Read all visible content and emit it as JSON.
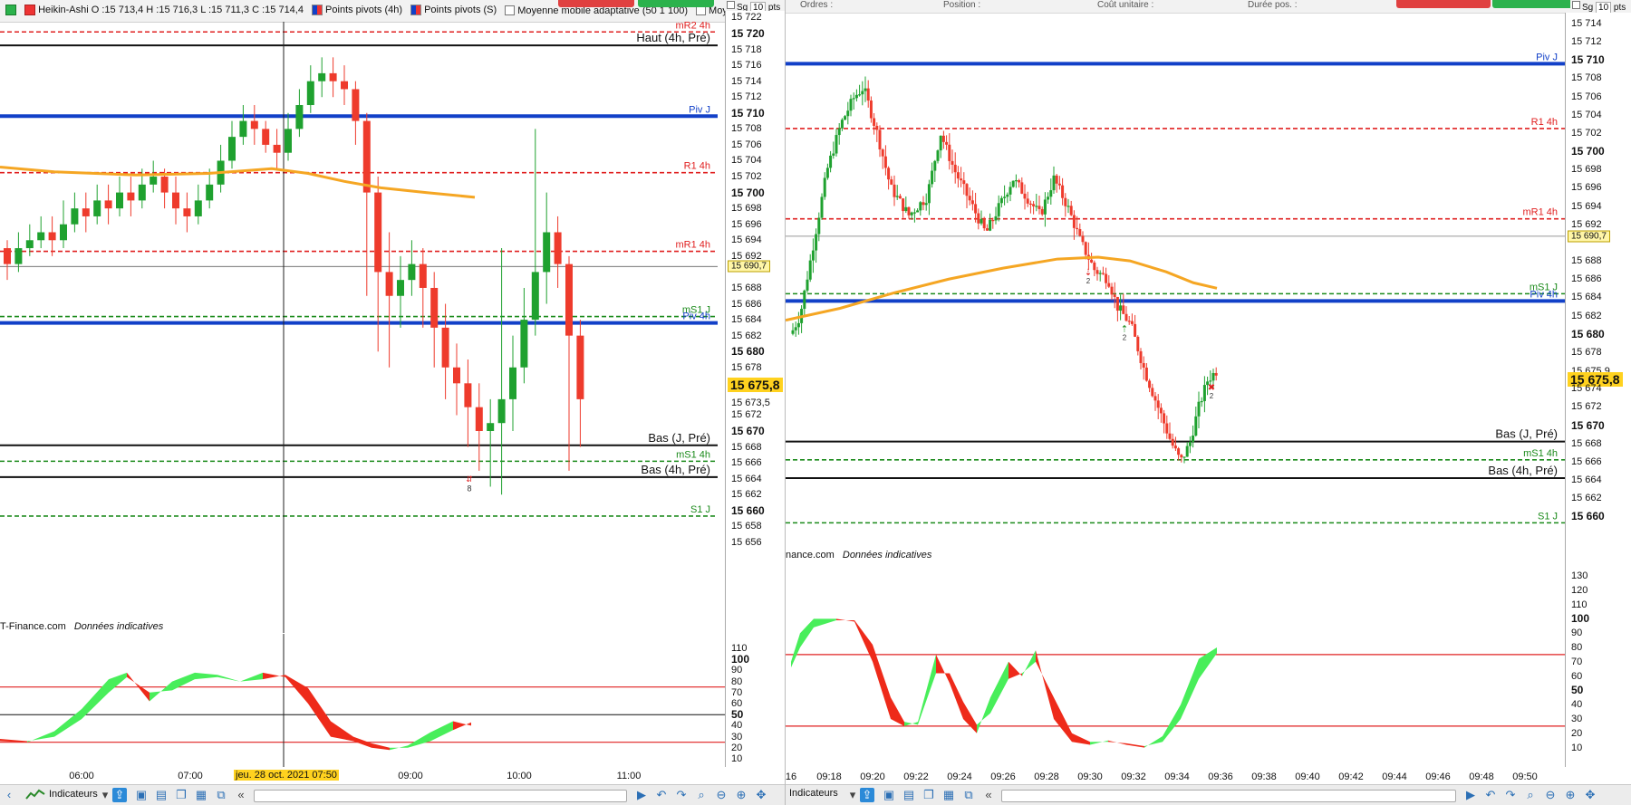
{
  "left": {
    "legend": {
      "heikin": "Heikin-Ashi O :15 713,4 H :15 716,3 L :15 711,3 C :15 714,4",
      "pivots4h": "Points pivots (4h)",
      "pivotsS": "Points pivots (S)",
      "mma": "Moyenne mobile adaptative (50 1 100)",
      "mma2": "Moyenne mobile ad"
    },
    "sg": "Sg",
    "pts_value": "10",
    "pts": "pts",
    "price_ticks": [
      "15 722",
      "15 720",
      "15 718",
      "15 716",
      "15 714",
      "15 712",
      "15 710",
      "15 708",
      "15 706",
      "15 704",
      "15 702",
      "15 700",
      "15 698",
      "15 696",
      "15 694",
      "15 692",
      "15 690,7",
      "15 688",
      "15 686",
      "15 684",
      "15 682",
      "15 680",
      "15 678",
      "15 675,8",
      "15 673,5",
      "15 672",
      "15 670",
      "15 668",
      "15 666",
      "15 664",
      "15 662",
      "15 660",
      "15 658",
      "15 656"
    ],
    "level_labels": {
      "mr2": "mR2 4h",
      "haut": "Haut (4h, Pré)",
      "pivj": "Piv J",
      "r1": "R1 4h",
      "mr1": "mR1 4h",
      "ms1j": "mS1 J",
      "piv4h": "Piv 4h",
      "basj": "Bas (J, Pré)",
      "ms14h": "mS1 4h",
      "bas4h": "Bas (4h, Pré)",
      "s1j": "S1 J"
    },
    "marker_count": "8",
    "source": "T-Finance.com",
    "source_note": "Données indicatives",
    "osc_ticks": [
      "110",
      "100",
      "90",
      "80",
      "70",
      "60",
      "50",
      "40",
      "30",
      "20",
      "10"
    ],
    "time_labels": [
      "06:00",
      "07:00",
      "09:00",
      "10:00",
      "11:00"
    ],
    "cursor_date": "jeu. 28 oct. 2021 07:50",
    "indicators_label": "Indicateurs"
  },
  "right": {
    "header": {
      "orders": "Ordres :",
      "position": "Position :",
      "unit_cost": "Coût unitaire :",
      "duration": "Durée pos. :"
    },
    "sg": "Sg",
    "pts_value": "10",
    "pts": "pts",
    "price_ticks": [
      "15 714",
      "15 712",
      "15 710",
      "15 708",
      "15 706",
      "15 704",
      "15 702",
      "15 700",
      "15 698",
      "15 696",
      "15 694",
      "15 692",
      "15 690,7",
      "15 688",
      "15 686",
      "15 684",
      "15 682",
      "15 680",
      "15 678",
      "15 675,9",
      "15 675,8",
      "15 674",
      "15 672",
      "15 670",
      "15 668",
      "15 666",
      "15 664",
      "15 662",
      "15 660"
    ],
    "level_labels": {
      "pivj": "Piv J",
      "r1": "R1 4h",
      "mr1": "mR1 4h",
      "ms1j": "mS1 J",
      "piv4h": "Piv 4h",
      "basj": "Bas (J, Pré)",
      "ms14h": "mS1 4h",
      "bas4h": "Bas (4h, Pré)",
      "s1j": "S1 J"
    },
    "marker_counts": [
      "2",
      "2",
      "2"
    ],
    "source": "nance.com",
    "source_note": "Données indicatives",
    "osc_ticks": [
      "130",
      "120",
      "110",
      "100",
      "90",
      "80",
      "70",
      "60",
      "50",
      "40",
      "30",
      "20",
      "10"
    ],
    "time_labels": [
      "16",
      "09:18",
      "09:20",
      "09:22",
      "09:24",
      "09:26",
      "09:28",
      "09:30",
      "09:32",
      "09:34",
      "09:36",
      "09:38",
      "09:40",
      "09:42",
      "09:44",
      "09:46",
      "09:48",
      "09:50"
    ],
    "indicators_label": "Indicateurs"
  },
  "colors": {
    "up": "#1fa12f",
    "down": "#ee3b2c",
    "pivot_blue": "#1240c8",
    "red_dash": "#e02020",
    "green_dash": "#1a8a1a",
    "ma_orange": "#f5a623",
    "osc_green": "#48ee5a",
    "osc_red": "#ee2a1a",
    "highlight": "#ffd21f"
  }
}
